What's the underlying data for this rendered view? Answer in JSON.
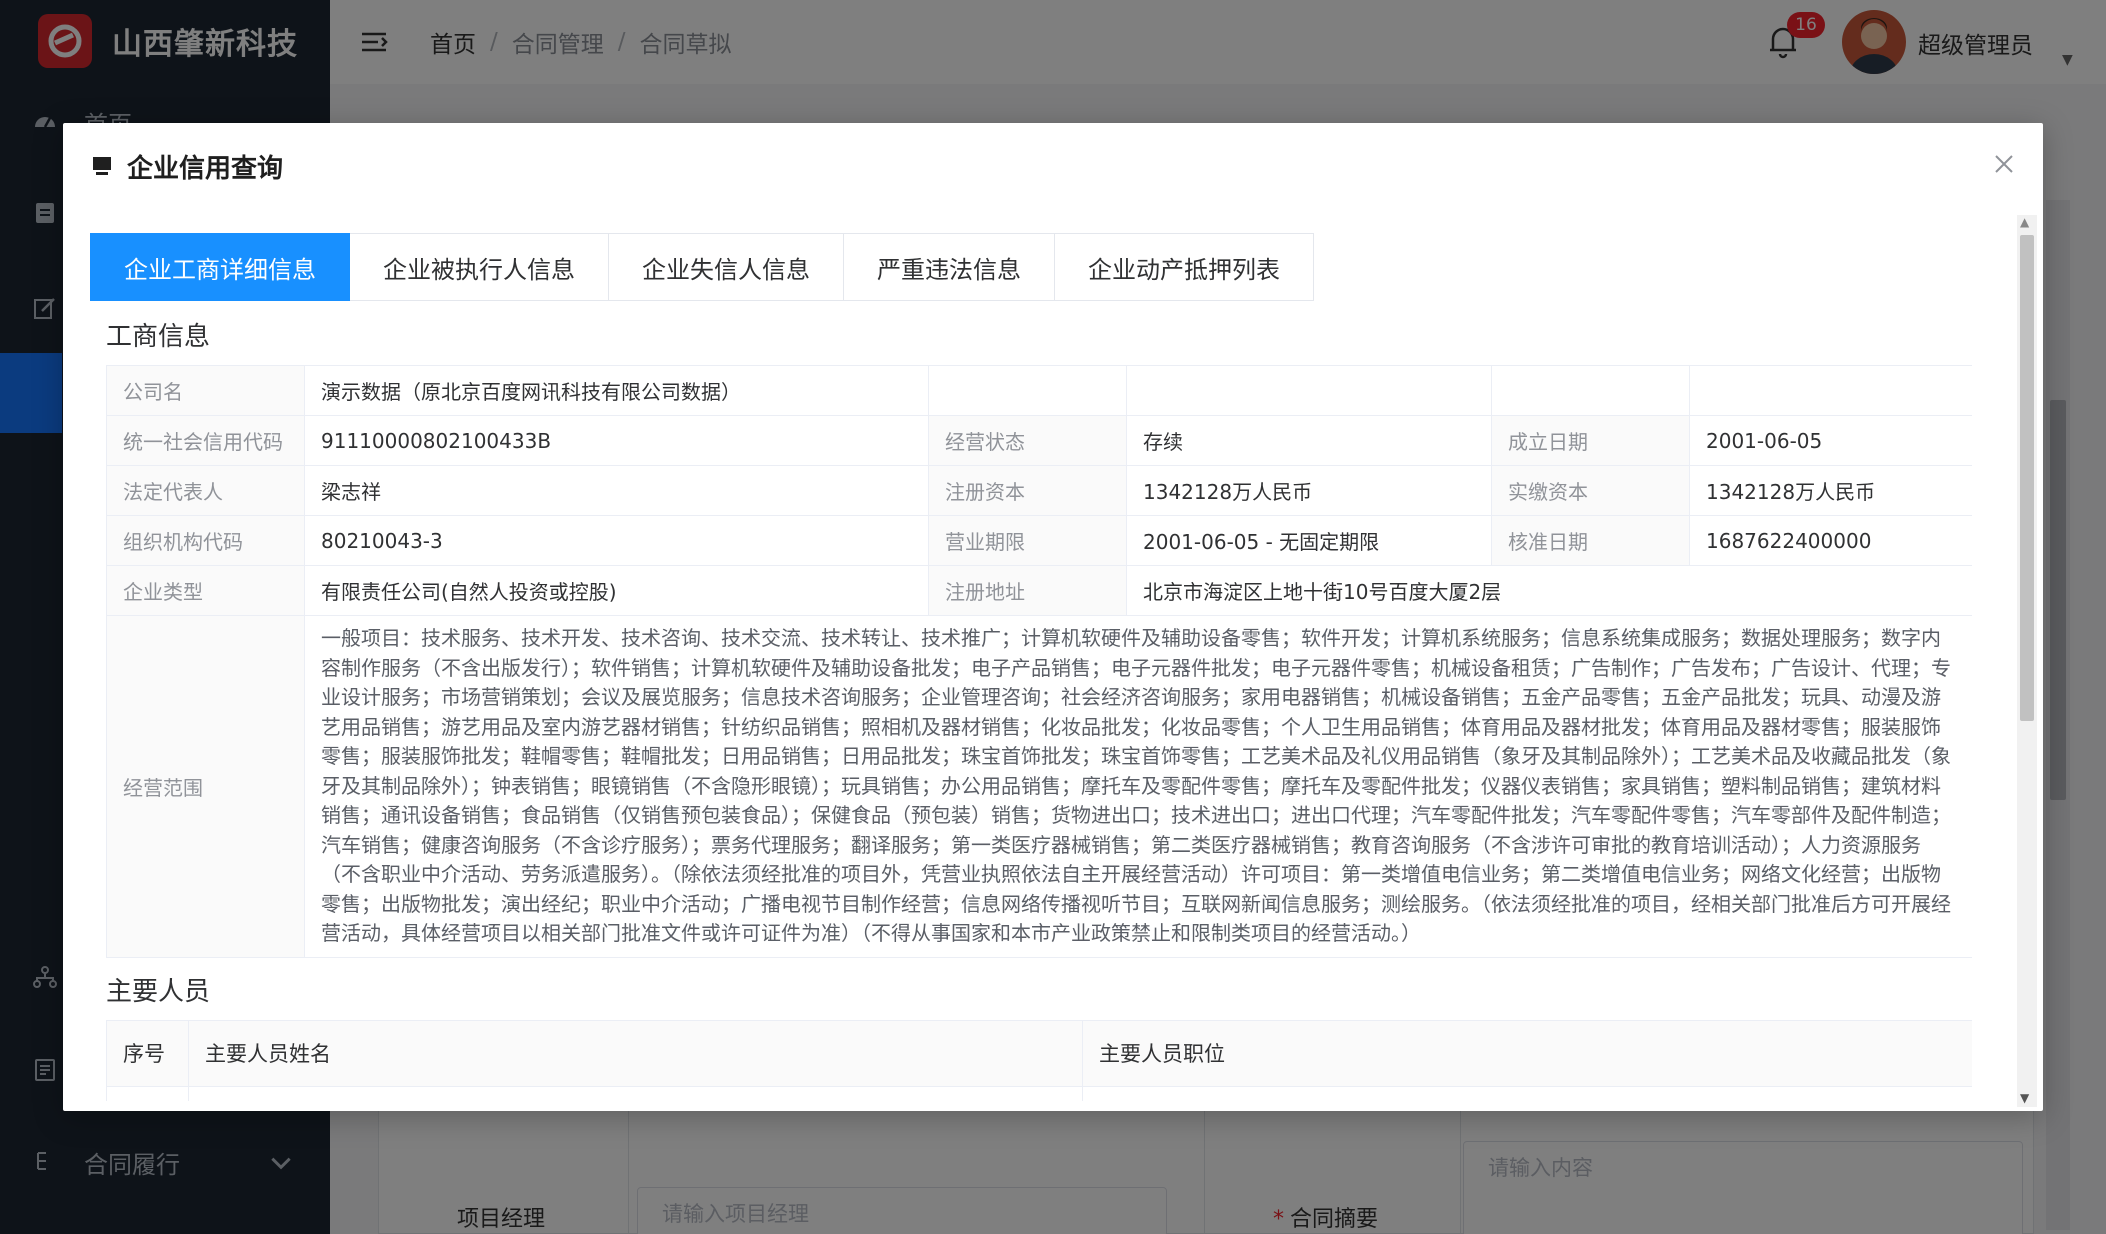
{
  "app": {
    "brand": "山西肇新科技",
    "brand_color": "#d7282f",
    "accent_color": "#1890ff"
  },
  "sidebar": {
    "items": [
      {
        "label": "首页",
        "icon": "dashboard-icon"
      },
      {
        "label": "",
        "icon": "document-icon"
      },
      {
        "label": "",
        "icon": "edit-icon"
      },
      {
        "label": "",
        "icon": "active-menu"
      },
      {
        "label": "",
        "icon": "org-chart-icon"
      },
      {
        "label": "",
        "icon": "report-icon"
      },
      {
        "label": "合同履行",
        "icon": "tree-icon"
      }
    ]
  },
  "topbar": {
    "breadcrumb": [
      "首页",
      "合同管理",
      "合同草拟"
    ],
    "notification_count": "16",
    "username": "超级管理员"
  },
  "background_form": {
    "project_manager_label": "项目经理",
    "project_manager_placeholder": "请输入项目经理",
    "summary_label": "合同摘要",
    "summary_placeholder": "请输入内容"
  },
  "modal": {
    "title": "企业信用查询",
    "tabs": [
      "企业工商详细信息",
      "企业被执行人信息",
      "企业失信人信息",
      "严重违法信息",
      "企业动产抵押列表"
    ],
    "active_tab": 0,
    "business_section_title": "工商信息",
    "business_info": {
      "company_name_label": "公司名",
      "company_name": "演示数据（原北京百度网讯科技有限公司数据）",
      "credit_code_label": "统一社会信用代码",
      "credit_code": "91110000802100433B",
      "status_label": "经营状态",
      "status": "存续",
      "established_label": "成立日期",
      "established": "2001-06-05",
      "legal_rep_label": "法定代表人",
      "legal_rep": "梁志祥",
      "reg_capital_label": "注册资本",
      "reg_capital": "1342128万人民币",
      "paid_capital_label": "实缴资本",
      "paid_capital": "1342128万人民币",
      "org_code_label": "组织机构代码",
      "org_code": "80210043-3",
      "term_label": "营业期限",
      "term": "2001-06-05 - 无固定期限",
      "approval_label": "核准日期",
      "approval": "1687622400000",
      "type_label": "企业类型",
      "type": "有限责任公司(自然人投资或控股)",
      "address_label": "注册地址",
      "address": "北京市海淀区上地十街10号百度大厦2层",
      "scope_label": "经营范围",
      "scope": "一般项目：技术服务、技术开发、技术咨询、技术交流、技术转让、技术推广；计算机软硬件及辅助设备零售；软件开发；计算机系统服务；信息系统集成服务；数据处理服务；数字内容制作服务（不含出版发行）；软件销售；计算机软硬件及辅助设备批发；电子产品销售；电子元器件批发；电子元器件零售；机械设备租赁；广告制作；广告发布；广告设计、代理；专业设计服务；市场营销策划；会议及展览服务；信息技术咨询服务；企业管理咨询；社会经济咨询服务；家用电器销售；机械设备销售；五金产品零售；五金产品批发；玩具、动漫及游艺用品销售；游艺用品及室内游艺器材销售；针纺织品销售；照相机及器材销售；化妆品批发；化妆品零售；个人卫生用品销售；体育用品及器材批发；体育用品及器材零售；服装服饰零售；服装服饰批发；鞋帽零售；鞋帽批发；日用品销售；日用品批发；珠宝首饰批发；珠宝首饰零售；工艺美术品及礼仪用品销售（象牙及其制品除外）；工艺美术品及收藏品批发（象牙及其制品除外）；钟表销售；眼镜销售（不含隐形眼镜）；玩具销售；办公用品销售；摩托车及零配件零售；摩托车及零配件批发；仪器仪表销售；家具销售；塑料制品销售；建筑材料销售；通讯设备销售；食品销售（仅销售预包装食品）；保健食品（预包装）销售；货物进出口；技术进出口；进出口代理；汽车零配件批发；汽车零配件零售；汽车零部件及配件制造；汽车销售；健康咨询服务（不含诊疗服务）；票务代理服务；翻译服务；第一类医疗器械销售；第二类医疗器械销售；教育咨询服务（不含涉许可审批的教育培训活动）；人力资源服务（不含职业中介活动、劳务派遣服务）。（除依法须经批准的项目外，凭营业执照依法自主开展经营活动）许可项目：第一类增值电信业务；第二类增值电信业务；网络文化经营；出版物零售；出版物批发；演出经纪；职业中介活动；广播电视节目制作经营；信息网络传播视听节目；互联网新闻信息服务；测绘服务。（依法须经批准的项目，经相关部门批准后方可开展经营活动，具体经营项目以相关部门批准文件或许可证件为准）（不得从事国家和本市产业政策禁止和限制类项目的经营活动。）"
    },
    "staff_section_title": "主要人员",
    "staff_columns": [
      "序号",
      "主要人员姓名",
      "主要人员职位"
    ]
  }
}
